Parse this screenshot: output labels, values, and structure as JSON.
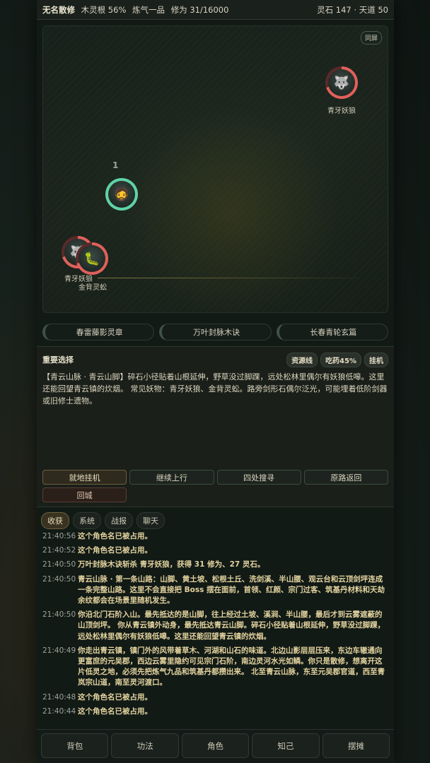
{
  "topbar": {
    "name": "无名散修",
    "root": "木灵根 56%",
    "realm": "炼气一品",
    "cultivation": "修为 31/16000",
    "resources": "灵石 147 · 天道 50"
  },
  "map": {
    "fullscreen_label": "同屏",
    "player_number": "1",
    "enemies": [
      {
        "label": "青牙妖狼",
        "hp_fraction": 0.7
      },
      {
        "label": "青牙妖狼",
        "hp_fraction": 0.7
      },
      {
        "label": "金背灵蚣",
        "hp_fraction": 0.7
      }
    ]
  },
  "skills": [
    "春雷藤影灵章",
    "万叶封脉木诀",
    "长春青轮玄篇"
  ],
  "event": {
    "title": "重要选择",
    "chips": [
      "资源线",
      "吃药45%",
      "挂机"
    ],
    "text": "【青云山脉 · 青云山脚】碎石小径贴着山根延伸，野草没过脚踝，远处松林里偶尔有妖狼低嗥。这里还能回望青云镇的炊烟。 常见妖物：青牙妖狼、金背灵蚣。路旁剑形石偶尔泛光，可能埋着低阶剑器或旧修士遗物。",
    "actions": [
      "就地挂机",
      "继续上行",
      "四处搜寻",
      "原路返回",
      "回城"
    ]
  },
  "log_tabs": [
    "收获",
    "系统",
    "战报",
    "聊天"
  ],
  "log": [
    {
      "time": "21:40:56",
      "msg": "这个角色名已被占用。"
    },
    {
      "time": "21:40:52",
      "msg": "这个角色名已被占用。"
    },
    {
      "time": "21:40:50",
      "msg": "万叶封脉木诀斩杀 青牙妖狼，获得 31 修为、27 灵石。"
    },
    {
      "time": "21:40:50",
      "msg": "青云山脉 · 第一条山路：山脚、黄土坡、松根土丘、洗剑溪、半山腰、观云台和云顶剑坪连成一条完整山路。这里不会直接把 Boss 摆在面前，首领、红颜、宗门过客、筑基丹材料和天劫余纹都会在场景里随机发生。"
    },
    {
      "time": "21:40:50",
      "msg": "你沿北门石阶入山。最先抵达的是山脚，往上经过土坡、溪涧、半山腰，最后才到云雾遮蔽的山顶剑坪。 你从青云镇外动身，最先抵达青云山脚。碎石小径贴着山根延伸，野草没过脚踝，远处松林里偶尔有妖狼低嗥。这里还能回望青云镇的炊烟。"
    },
    {
      "time": "21:40:49",
      "msg": "你走出青云镇，镇门外的风带着草木、河湖和山石的味道。北边山影层层压来，东边车辙通向更富庶的元吴郡，西边云雾里隐约可见宗门石阶，南边灵河水光如鳞。你只是散修，想离开这片低灵之地，必须先把炼气九品和筑基丹都攒出来。 北至青云山脉，东至元吴郡官道，西至青岚宗山道，南至灵河渡口。"
    },
    {
      "time": "21:40:48",
      "msg": "这个角色名已被占用。"
    },
    {
      "time": "21:40:44",
      "msg": "这个角色名已被占用。"
    }
  ],
  "bottom_nav": [
    "背包",
    "功法",
    "角色",
    "知己",
    "摆摊"
  ]
}
